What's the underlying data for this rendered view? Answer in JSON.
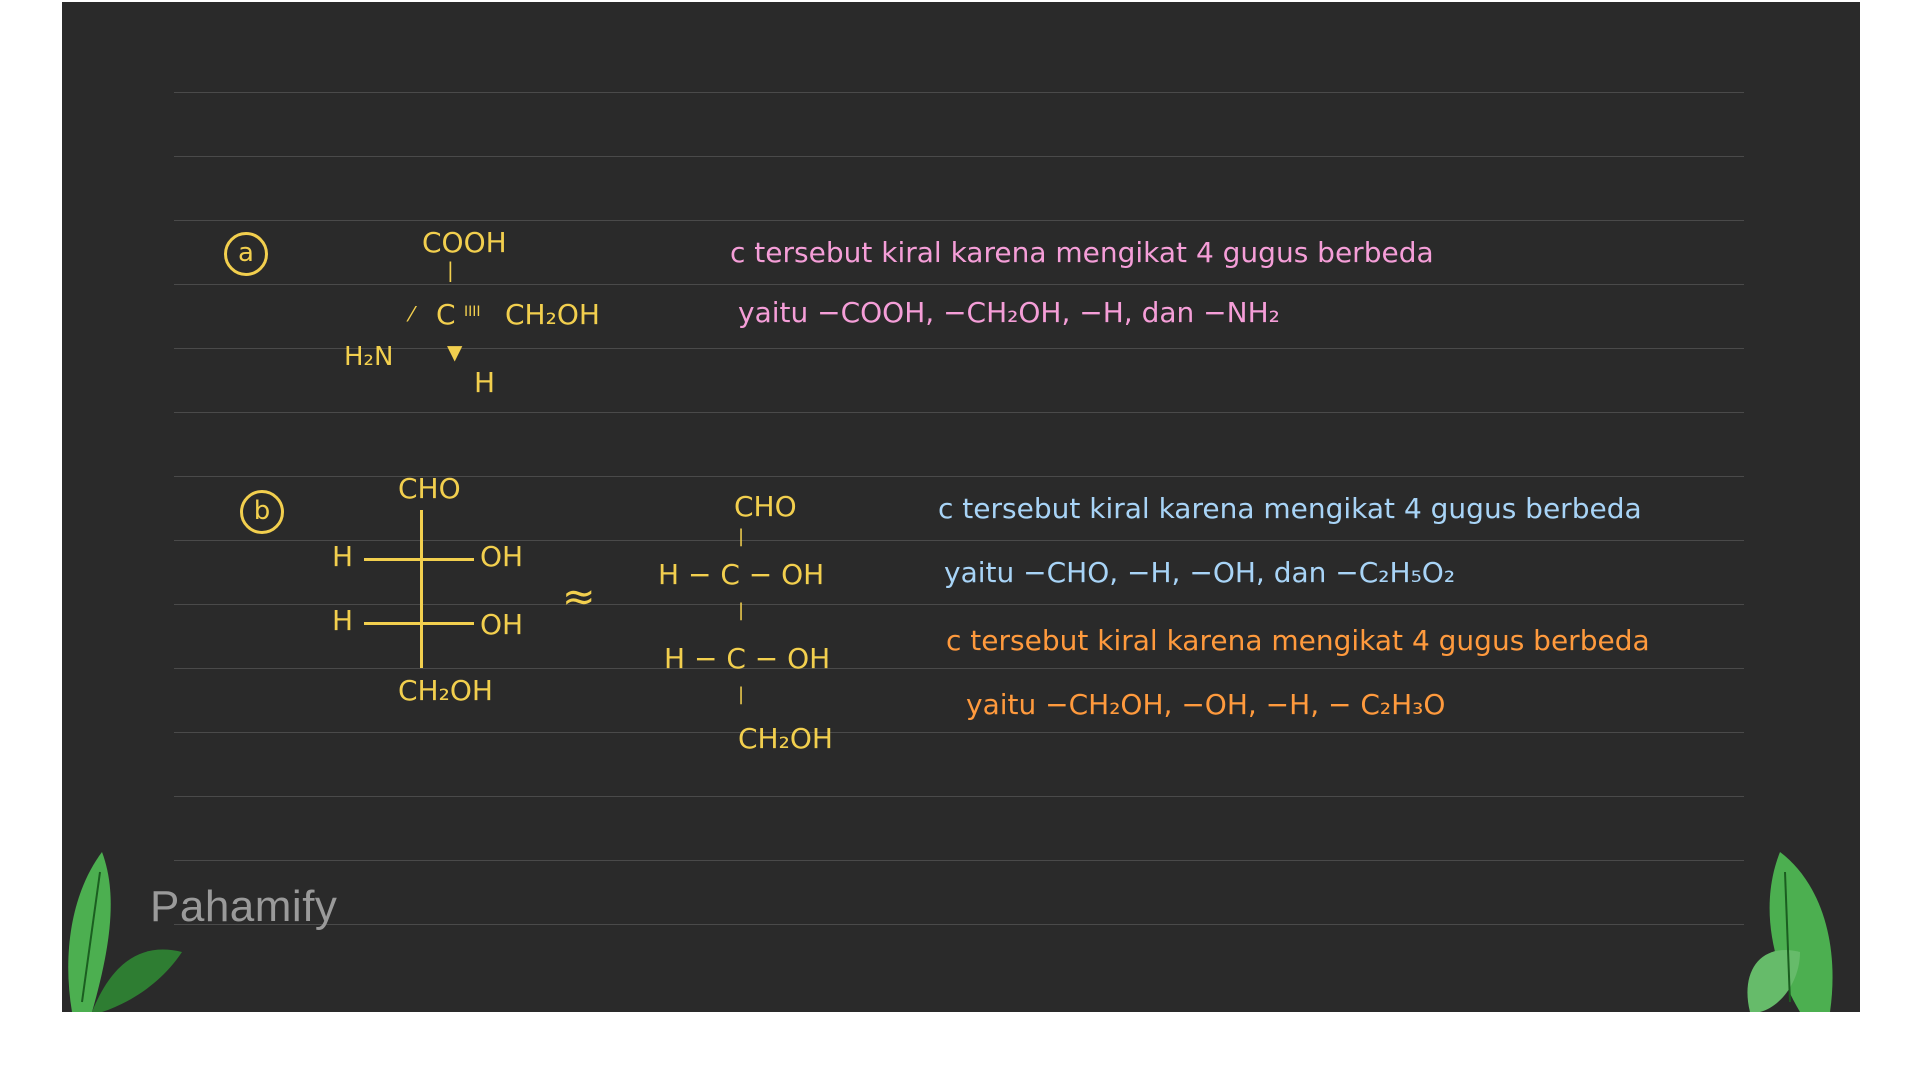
{
  "brand": {
    "name": "Pahamify"
  },
  "colors": {
    "board": "#2a2a2a",
    "yellow": "#f2cf4e",
    "pink": "#f59ed8",
    "blue": "#a8d4f7",
    "orange": "#ff9a3d",
    "leaf": "#4caf50"
  },
  "part_a": {
    "marker": "a",
    "structure": {
      "top": "COOH",
      "bond_top": "|",
      "center": "C",
      "dash": "IIII",
      "right": "CH₂OH",
      "left": "H₂N",
      "bottom": "H"
    },
    "explanation": [
      "c tersebut kiral karena mengikat 4 gugus berbeda",
      "yaitu −COOH, −CH₂OH, −H, dan −NH₂"
    ]
  },
  "part_b": {
    "marker": "b",
    "fischer": {
      "top": "CHO",
      "row1_left": "H",
      "row1_right": "OH",
      "row2_left": "H",
      "row2_right": "OH",
      "bottom": "CH₂OH"
    },
    "approx": "≈",
    "expanded": {
      "top": "CHO",
      "row1": "H − C − OH",
      "row2": "H − C − OH",
      "bottom": "CH₂OH",
      "bond": "|"
    },
    "explanation_1": [
      "c tersebut kiral karena mengikat 4 gugus berbeda",
      "yaitu −CHO, −H, −OH, dan −C₂H₅O₂"
    ],
    "explanation_2": [
      "c tersebut kiral karena mengikat 4 gugus berbeda",
      "yaitu −CH₂OH, −OH, −H, − C₂H₃O"
    ]
  }
}
